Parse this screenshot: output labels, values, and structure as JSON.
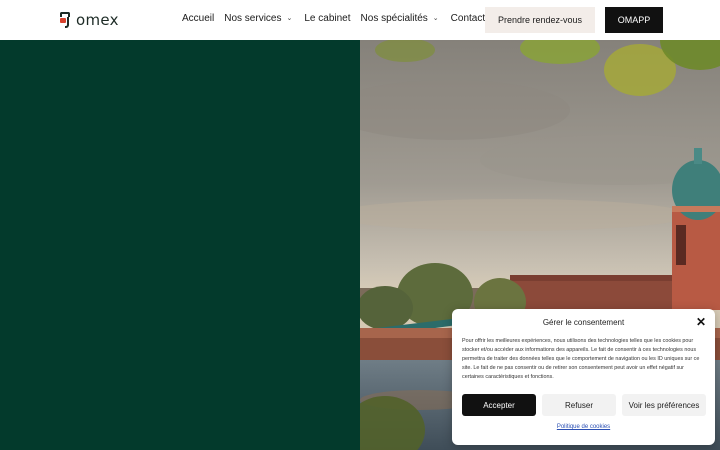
{
  "brand": {
    "name": "omex"
  },
  "nav": {
    "items": [
      {
        "label": "Accueil",
        "has_dropdown": false
      },
      {
        "label": "Nos services",
        "has_dropdown": true
      },
      {
        "label": "Le cabinet",
        "has_dropdown": false
      },
      {
        "label": "Nos spécialités",
        "has_dropdown": true
      },
      {
        "label": "Contact",
        "has_dropdown": false
      }
    ],
    "cta_primary": "Prendre rendez-vous",
    "cta_secondary": "OMAPP"
  },
  "colors": {
    "hero_panel": "#033a2c",
    "logo_accent": "#d8432f",
    "cta_light_bg": "#f3ede9",
    "cta_dark_bg": "#111111"
  },
  "consent": {
    "title": "Gérer le consentement",
    "text": "Pour offrir les meilleures expériences, nous utilisons des technologies telles que les cookies pour stocker et/ou accéder aux informations des appareils. Le fait de consentir à ces technologies nous permettra de traiter des données telles que le comportement de navigation ou les ID uniques sur ce site. Le fait de ne pas consentir ou de retirer son consentement peut avoir un effet négatif sur certaines caractéristiques et fonctions.",
    "accept_label": "Accepter",
    "refuse_label": "Refuser",
    "prefs_label": "Voir les préférences",
    "policy_link": "Politique de cookies"
  }
}
